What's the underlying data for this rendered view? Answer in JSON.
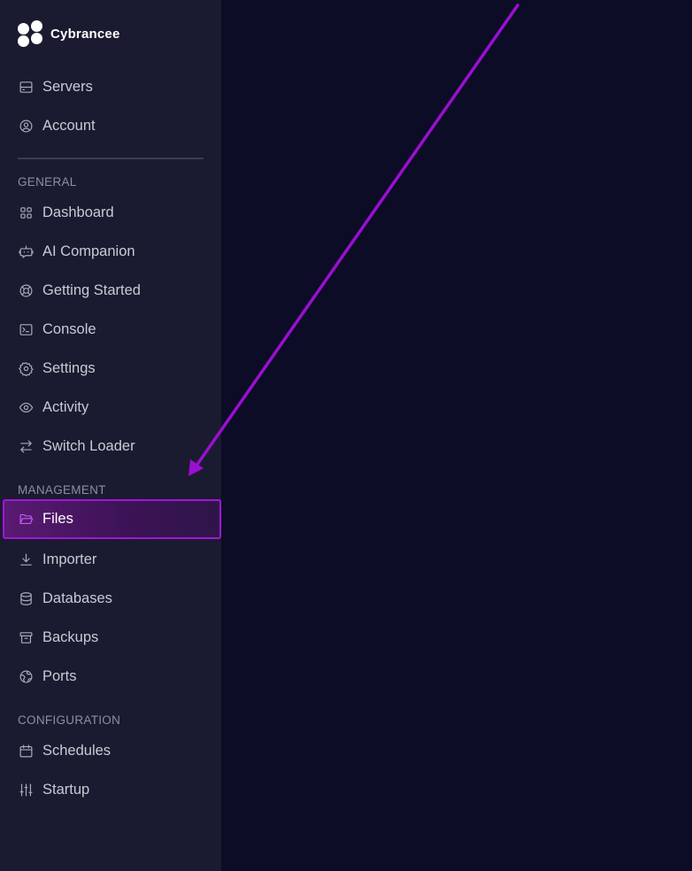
{
  "brand": {
    "name": "Cybrancee",
    "logo_icon": "four-dots-logo"
  },
  "account_nav": [
    {
      "label": "Servers",
      "icon": "server-icon"
    },
    {
      "label": "Account",
      "icon": "user-circle-icon"
    }
  ],
  "sections": {
    "general": "GENERAL",
    "management": "MANAGEMENT",
    "configuration": "CONFIGURATION"
  },
  "general_nav": [
    {
      "label": "Dashboard",
      "icon": "grid-icon"
    },
    {
      "label": "AI Companion",
      "icon": "robot-chat-icon"
    },
    {
      "label": "Getting Started",
      "icon": "life-ring-icon"
    },
    {
      "label": "Console",
      "icon": "terminal-icon"
    },
    {
      "label": "Settings",
      "icon": "gear-icon"
    },
    {
      "label": "Activity",
      "icon": "eye-icon"
    },
    {
      "label": "Switch Loader",
      "icon": "arrows-switch-icon"
    }
  ],
  "management_nav": [
    {
      "label": "Files",
      "icon": "folder-open-icon",
      "active": true
    },
    {
      "label": "Importer",
      "icon": "download-icon"
    },
    {
      "label": "Databases",
      "icon": "database-icon"
    },
    {
      "label": "Backups",
      "icon": "archive-icon"
    },
    {
      "label": "Ports",
      "icon": "globe-icon"
    }
  ],
  "configuration_nav": [
    {
      "label": "Schedules",
      "icon": "calendar-icon"
    },
    {
      "label": "Startup",
      "icon": "sliders-icon"
    }
  ],
  "colors": {
    "sidebar_bg": "#1a1b30",
    "main_bg": "#0c0c27",
    "accent": "#a216d6",
    "arrow": "#9a0fd0"
  },
  "annotation": {
    "type": "arrow",
    "points_to": "Files"
  }
}
